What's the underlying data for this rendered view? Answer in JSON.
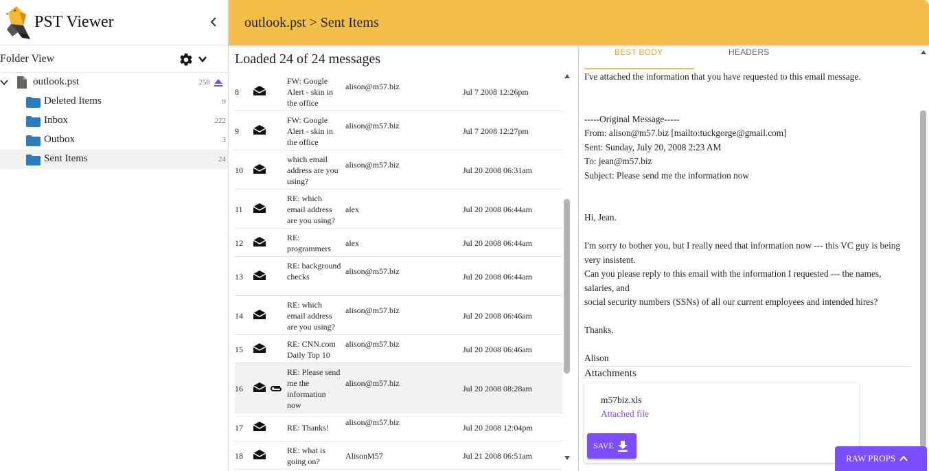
{
  "app": {
    "title": "PST Viewer"
  },
  "sidebar": {
    "folder_view_label": "Folder View",
    "root": {
      "name": "outlook.pst",
      "count": "258"
    },
    "folders": [
      {
        "name": "Deleted Items",
        "count": "9"
      },
      {
        "name": "Inbox",
        "count": "222"
      },
      {
        "name": "Outbox",
        "count": "3"
      },
      {
        "name": "Sent Items",
        "count": "24"
      }
    ]
  },
  "header": {
    "breadcrumb": "outlook.pst > Sent Items"
  },
  "list": {
    "loaded_text": "Loaded 24 of 24 messages",
    "messages": [
      {
        "num": "8",
        "subject": "FW: Google Alert - skin in the office",
        "from": "alison@m57.biz",
        "date": "Jul 7 2008 12:26pm"
      },
      {
        "num": "9",
        "subject": "FW: Google Alert - skin in the office",
        "from": "alison@m57.biz",
        "date": "Jul 7 2008 12:27pm"
      },
      {
        "num": "10",
        "subject": "which email address are you using?",
        "from": "alison@m57.biz",
        "date": "Jul 20 2008 06:31am"
      },
      {
        "num": "11",
        "subject": "RE: which email address are you using?",
        "from": "alex",
        "date": "Jul 20 2008 06:44am"
      },
      {
        "num": "12",
        "subject": "RE: programmers",
        "from": "alex",
        "date": "Jul 20 2008 06:44am"
      },
      {
        "num": "13",
        "subject": "RE: background checks",
        "from": "alison@m57.biz",
        "date": "Jul 20 2008 06:44am"
      },
      {
        "num": "14",
        "subject": "RE: which email address are you using?",
        "from": "alison@m57.biz",
        "date": "Jul 20 2008 06:46am"
      },
      {
        "num": "15",
        "subject": "RE: CNN.com Daily Top 10",
        "from": "alison@m57.biz",
        "date": "Jul 20 2008 06:46am"
      },
      {
        "num": "16",
        "subject": "RE: Please send me the information now",
        "from": "alison@m57.biz",
        "date": "Jul 20 2008 08:28am"
      },
      {
        "num": "17",
        "subject": "RE: Thanks!",
        "from": "alison@m57.biz",
        "date": "Jul 20 2008 12:04pm"
      },
      {
        "num": "18",
        "subject": "RE: what is going on?",
        "from": "AlisonM57",
        "date": "Jul 21 2008 06:51am"
      }
    ]
  },
  "detail": {
    "tabs": [
      "BEST BODY",
      "HEADERS"
    ],
    "body": "I've attached the information that you have requested to this email message.\n\n\n-----Original Message-----\nFrom: alison@m57.biz [mailto:tuckgorge@gmail.com]\nSent: Sunday, July 20, 2008 2:23 AM\nTo: jean@m57.biz\nSubject: Please send me the information now\n\n\nHi, Jean.\n\nI'm sorry to bother you, but I really need that information now --- this VC guy is being very insistent.\nCan you please reply to this email with the information I requested --- the names, salaries, and\nsocial security numbers (SSNs) of all our current employees and intended hires?\n\nThanks.\n\nAlison",
    "attachments_title": "Attachments",
    "attachment": {
      "name": "m57biz.xls",
      "link": "Attached file",
      "save_label": "SAVE"
    },
    "raw_props_label": "RAW PROPS"
  },
  "colors": {
    "header": "#f4bf48",
    "accent": "#7c4dff",
    "folder": "#2b7bbd"
  },
  "icons": [
    "collapse-icon",
    "gear-icon",
    "chevron-down-icon",
    "file-icon",
    "eject-icon",
    "folder-icon",
    "envelope-icon",
    "paperclip-icon",
    "download-icon",
    "chevron-up-icon"
  ]
}
